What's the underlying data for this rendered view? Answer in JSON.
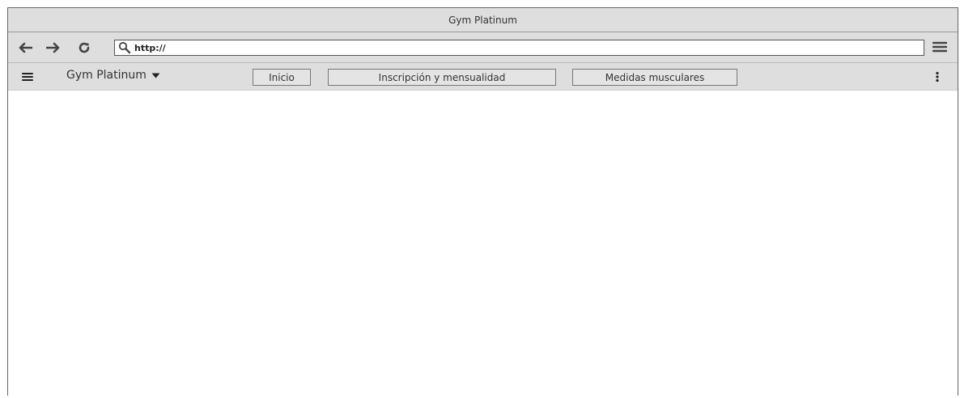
{
  "window": {
    "title": "Gym Platinum"
  },
  "addressbar": {
    "back_icon": "arrow-left-icon",
    "forward_icon": "arrow-right-icon",
    "reload_icon": "reload-icon",
    "search_icon": "search-icon",
    "url": "http://",
    "menu_icon": "hamburger-icon"
  },
  "menubar": {
    "menu_icon": "hamburger-icon",
    "brand": "Gym Platinum",
    "brand_dropdown_icon": "caret-down-icon",
    "items": [
      {
        "label": "Inicio"
      },
      {
        "label": "Inscripción y mensualidad"
      },
      {
        "label": "Medidas musculares"
      }
    ],
    "more_icon": "vertical-ellipsis-icon"
  }
}
